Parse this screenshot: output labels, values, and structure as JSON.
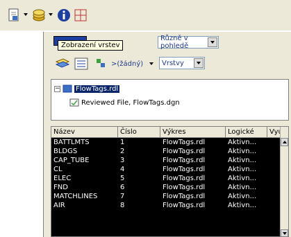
{
  "toolbar": {
    "buttons": [
      {
        "name": "document-icon"
      },
      {
        "name": "layers-icon"
      },
      {
        "name": "info-icon"
      },
      {
        "name": "fit-view-icon"
      }
    ]
  },
  "tooltip": {
    "text": "Zobrazení vrstev"
  },
  "panel": {
    "view_combo": "Různě v pohledě",
    "level_combo": ">(žádný)",
    "views_combo": "Vrstvy"
  },
  "tree": {
    "root": "FlowTags.rdl",
    "child": "Reviewed File, FlowTags.dgn"
  },
  "table": {
    "headers": [
      "Název",
      "Číslo",
      "Výkres",
      "Logické",
      "Využito"
    ],
    "rows": [
      [
        "BATTLMTS",
        "1",
        "FlowTags.rdl",
        "Aktivn..."
      ],
      [
        "BLDGS",
        "2",
        "FlowTags.rdl",
        "Aktivn..."
      ],
      [
        "CAP_TUBE",
        "3",
        "FlowTags.rdl",
        "Aktivn..."
      ],
      [
        "CL",
        "4",
        "FlowTags.rdl",
        "Aktivn..."
      ],
      [
        "ELEC",
        "5",
        "FlowTags.rdl",
        "Aktivn..."
      ],
      [
        "FND",
        "6",
        "FlowTags.rdl",
        "Aktivn..."
      ],
      [
        "MATCHLINES",
        "7",
        "FlowTags.rdl",
        "Aktivn..."
      ],
      [
        "AIR",
        "8",
        "FlowTags.rdl",
        "Aktivn..."
      ]
    ]
  }
}
